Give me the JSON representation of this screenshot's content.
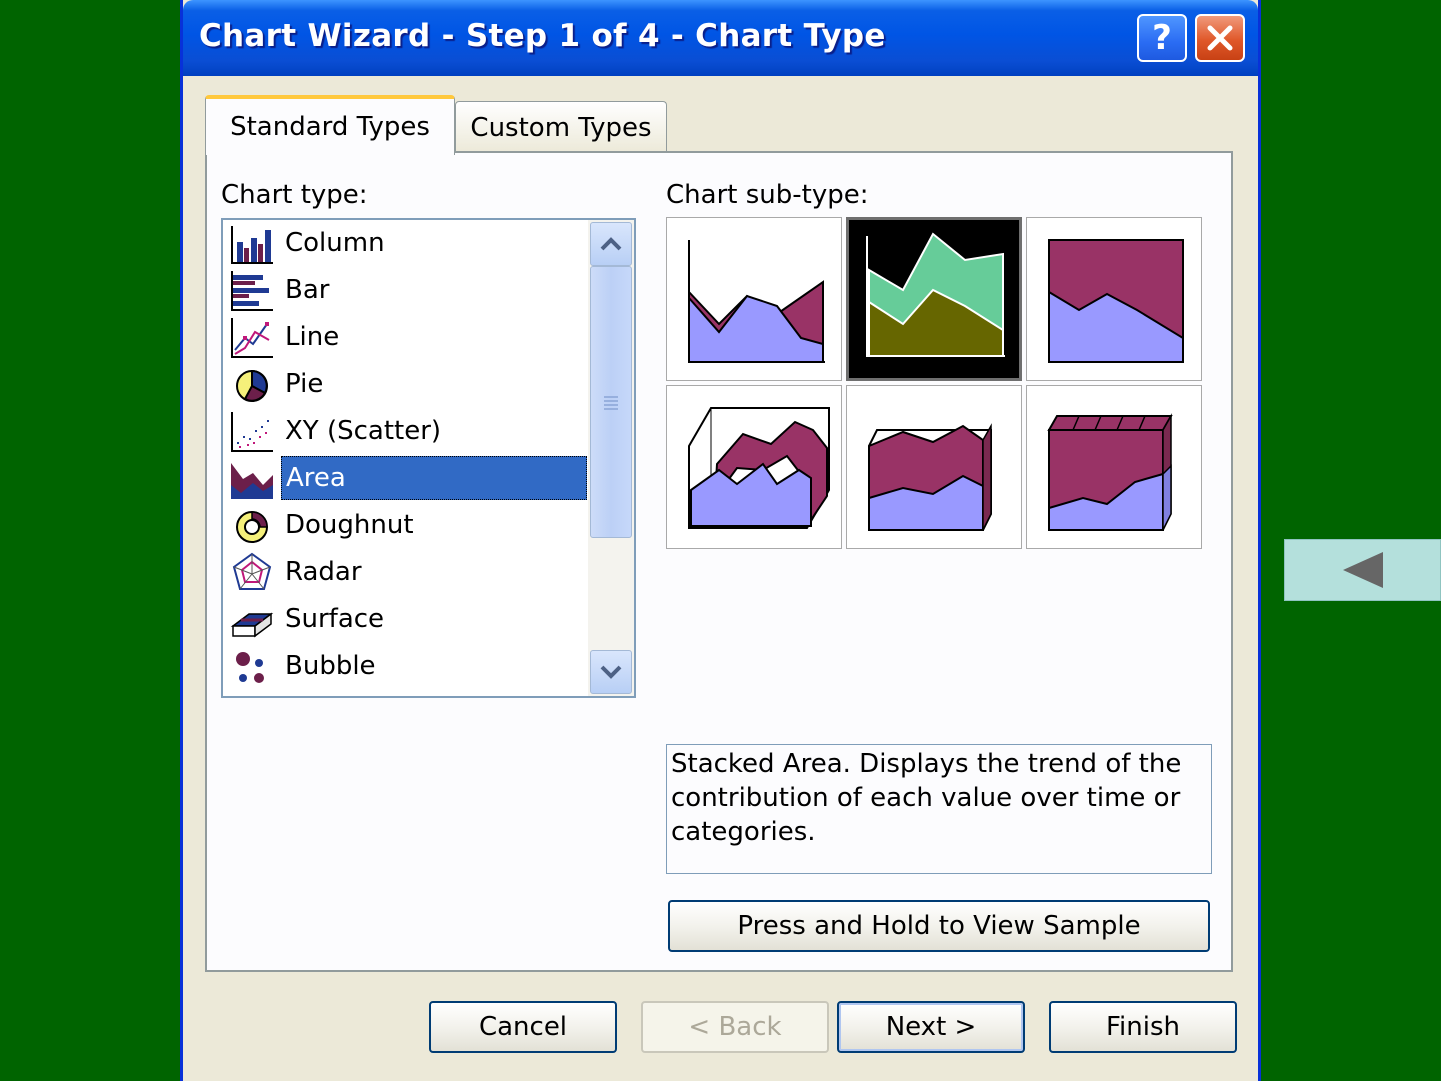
{
  "window": {
    "title": "Chart Wizard - Step 1 of 4 - Chart Type",
    "help_label": "?"
  },
  "tabs": [
    {
      "label": "Standard Types",
      "active": true
    },
    {
      "label": "Custom Types",
      "active": false
    }
  ],
  "chart_type_label": "Chart type:",
  "chart_subtype_label": "Chart sub-type:",
  "chart_types": [
    {
      "label": "Column",
      "icon": "column-chart-icon"
    },
    {
      "label": "Bar",
      "icon": "bar-chart-icon"
    },
    {
      "label": "Line",
      "icon": "line-chart-icon"
    },
    {
      "label": "Pie",
      "icon": "pie-chart-icon"
    },
    {
      "label": "XY (Scatter)",
      "icon": "scatter-chart-icon"
    },
    {
      "label": "Area",
      "icon": "area-chart-icon",
      "selected": true
    },
    {
      "label": "Doughnut",
      "icon": "doughnut-chart-icon"
    },
    {
      "label": "Radar",
      "icon": "radar-chart-icon"
    },
    {
      "label": "Surface",
      "icon": "surface-chart-icon"
    },
    {
      "label": "Bubble",
      "icon": "bubble-chart-icon"
    }
  ],
  "selected_subtype": "Stacked Area",
  "description": "Stacked Area. Displays the trend of the contribution of each value over time or categories.",
  "buttons": {
    "sample": "Press and Hold to View Sample",
    "cancel": "Cancel",
    "back": "< Back",
    "next": "Next >",
    "finish": "Finish"
  },
  "colors": {
    "background": "#006400",
    "series_1": "#9999ff",
    "series_2": "#993366",
    "selected_series_1": "#666600",
    "selected_series_2": "#66cc99",
    "selection": "#316ac5"
  }
}
